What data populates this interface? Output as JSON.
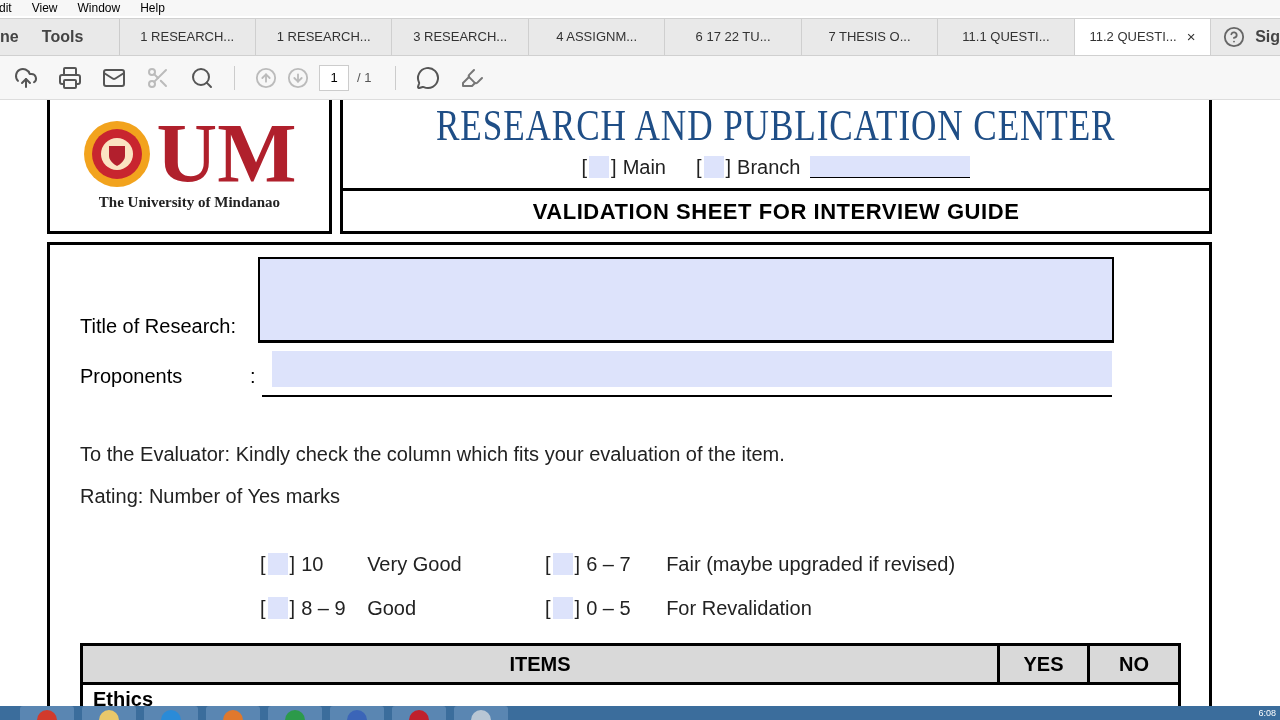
{
  "menu": [
    "dit",
    "View",
    "Window",
    "Help"
  ],
  "nav": [
    {
      "label": "ne"
    },
    {
      "label": "Tools"
    }
  ],
  "tabs": [
    {
      "label": "1 RESEARCH...",
      "selected": false
    },
    {
      "label": "1 RESEARCH...",
      "selected": false
    },
    {
      "label": "3 RESEARCH...",
      "selected": false
    },
    {
      "label": "4 ASSIGNM...",
      "selected": false
    },
    {
      "label": "6  17 22 TU...",
      "selected": false
    },
    {
      "label": "7  THESIS O...",
      "selected": false
    },
    {
      "label": "11.1 QUESTI...",
      "selected": false
    },
    {
      "label": "11.2 QUESTI...",
      "selected": true
    }
  ],
  "tab_close": "×",
  "sign": "Sig",
  "toolbar": {
    "page": "1",
    "page_total": "/ 1"
  },
  "document": {
    "logo_letters": "UM",
    "logo_caption": "The University of Mindanao",
    "center": "RESEARCH AND PUBLICATION CENTER",
    "campus": [
      {
        "open": "[",
        "close": "]",
        "label": "Main"
      },
      {
        "open": "[",
        "close": "]",
        "label": "Branch"
      }
    ],
    "sheet_title": "VALIDATION SHEET FOR INTERVIEW GUIDE",
    "fields": [
      {
        "label": "Title of Research:",
        "kind": "tall"
      },
      {
        "label": "Proponents",
        "colon": ":",
        "kind": "line"
      }
    ],
    "instruction": "To the Evaluator:  Kindly check the column which fits your evaluation of the item.",
    "rating_note": "Rating: Number of Yes marks",
    "ratings": [
      {
        "open": "[",
        "close": "]",
        "range": "10",
        "meaning": "Very Good"
      },
      {
        "open": "[",
        "close": "]",
        "range": "6 – 7",
        "meaning": "Fair (maybe upgraded if revised)"
      },
      {
        "open": "[",
        "close": "]",
        "range": "8 – 9",
        "meaning": "Good"
      },
      {
        "open": "[",
        "close": "]",
        "range": "0 – 5",
        "meaning": "For Revalidation"
      }
    ],
    "table": {
      "columns": [
        "ITEMS",
        "YES",
        "NO"
      ],
      "section": "Ethics"
    }
  },
  "taskbar": {
    "clock": "6:08"
  }
}
